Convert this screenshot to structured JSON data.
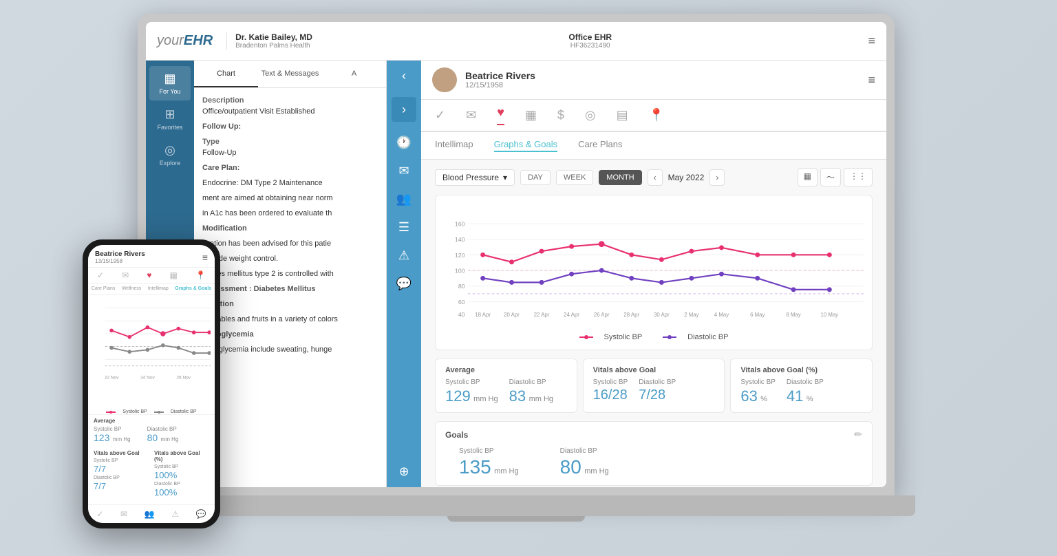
{
  "app": {
    "title": "yourEHR",
    "logo_your": "your",
    "logo_ehr": "EHR"
  },
  "topbar": {
    "doctor_name": "Dr. Katie Bailey, MD",
    "doctor_org": "Bradenton Palms Health",
    "office_name": "Office EHR",
    "office_id": "HF36231490",
    "menu_icon": "≡"
  },
  "left_sidebar": {
    "items": [
      {
        "label": "For You",
        "icon": "▦",
        "active": true
      },
      {
        "label": "Favorites",
        "icon": "⊞",
        "active": false
      },
      {
        "label": "Explore",
        "icon": "◎",
        "active": false
      }
    ]
  },
  "middle_panel": {
    "icons": [
      "🕐",
      "✉",
      "👥",
      "☰",
      "⚠",
      "💬",
      "⊕"
    ]
  },
  "chart_tabs": {
    "tabs": [
      "Chart",
      "Text & Messages",
      "A"
    ],
    "active": "Chart"
  },
  "chart_content": {
    "description_label": "Description",
    "description_value": "Office/outpatient Visit Established",
    "followup_label": "Follow Up:",
    "type_label": "Type",
    "type_value": "Follow-Up",
    "care_plan_label": "Care Plan:",
    "care_plan_value": "Endocrine: DM Type 2 Maintenance",
    "care_plan_text": "ment are aimed at obtaining near norm",
    "a1c_text": "in A1c has been ordered to evaluate th",
    "modification_label": "Modification",
    "modification_text": "fication has been advised for this patie",
    "weight_text": "provide weight control.",
    "diabetes_text": "abetes mellitus type 2 is controlled with",
    "assessment_label": "Assessment : Diabetes Mellitus",
    "nutrition_label": "Nutrition",
    "nutrition_text": "egetables and fruits in a variety of colors",
    "hypoglycemia_label": "Hypoglycemia",
    "hypoglycemia_text": "hypoglycemia include sweating, hunge"
  },
  "patient": {
    "name": "Beatrice Rivers",
    "dob": "12/15/1958",
    "avatar_text": "👤"
  },
  "patient_nav": {
    "icons": [
      "✓",
      "✉",
      "♥",
      "▦",
      "$",
      "◎",
      "▤",
      "📍"
    ],
    "active_index": 2
  },
  "content_tabs": {
    "tabs": [
      "Intellimap",
      "Graphs & Goals",
      "Care Plans"
    ],
    "active": "Graphs & Goals"
  },
  "graph": {
    "dropdown_label": "Blood Pressure",
    "time_options": [
      "DAY",
      "WEEK",
      "MONTH"
    ],
    "active_time": "MONTH",
    "period": "May 2022",
    "x_labels": [
      "18 Apr",
      "20 Apr",
      "22 Apr",
      "24 Apr",
      "26 Apr",
      "28 Apr",
      "30 Apr",
      "2 May",
      "4 May",
      "6 May",
      "8 May",
      "10 May"
    ],
    "y_labels": [
      "160",
      "140",
      "120",
      "100",
      "80",
      "60",
      "40"
    ],
    "systolic_color": "#e83070",
    "diastolic_color": "#7040c0",
    "systolic_label": "Systolic BP",
    "diastolic_label": "Diastolic BP"
  },
  "stats": {
    "average": {
      "title": "Average",
      "systolic_label": "Systolic BP",
      "systolic_value": "129",
      "systolic_unit": "mm Hg",
      "diastolic_label": "Diastolic BP",
      "diastolic_value": "83",
      "diastolic_unit": "mm Hg"
    },
    "vitals_above_goal": {
      "title": "Vitals above Goal",
      "systolic_label": "Systolic BP",
      "systolic_value": "16/28",
      "diastolic_label": "Diastolic BP",
      "diastolic_value": "7/28"
    },
    "vitals_above_goal_pct": {
      "title": "Vitals above Goal (%)",
      "systolic_label": "Systolic BP",
      "systolic_value": "63",
      "systolic_unit": "%",
      "diastolic_label": "Diastolic BP",
      "diastolic_value": "41",
      "diastolic_unit": "%"
    }
  },
  "goals": {
    "title": "Goals",
    "systolic_label": "Systolic BP",
    "systolic_value": "135",
    "systolic_unit": "mm Hg",
    "diastolic_label": "Diastolic BP",
    "diastolic_value": "80",
    "diastolic_unit": "mm Hg",
    "edit_icon": "✏"
  },
  "phone": {
    "patient_name": "Beatrice Rivers",
    "patient_dob": "13/15/1958",
    "tabs": [
      "Care Plans",
      "Wellness",
      "Intellimap",
      "Graphs & Goals"
    ],
    "active_tab": "Graphs & Goals",
    "stats": {
      "average_title": "Average",
      "systolic_label": "Systolic BP",
      "systolic_value": "123",
      "systolic_unit": "mm Hg",
      "diastolic_label": "Diastolic BP",
      "diastolic_value": "80",
      "diastolic_unit": "mm Hg"
    },
    "vitals": {
      "above_goal_title": "Vitals above Goal",
      "systolic_value": "7/7",
      "diastolic_value": "7/7",
      "pct_title": "Vitals above Goal (%)",
      "systolic_pct": "100%",
      "diastolic_pct": "100%"
    }
  }
}
